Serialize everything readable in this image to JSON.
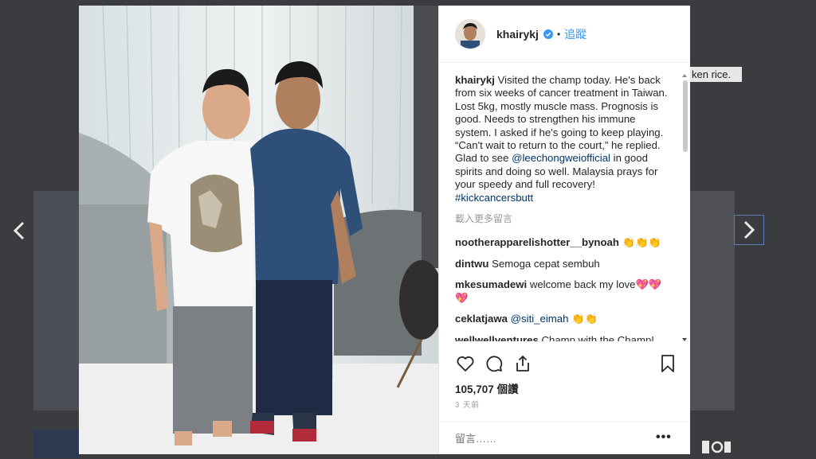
{
  "background": {
    "partial_text": "ken rice."
  },
  "post": {
    "username": "khairykj",
    "follow_label": "追蹤",
    "caption_username": "khairykj",
    "caption_before": " Visited the champ today. He's back from six weeks of cancer treatment in Taiwan. Lost 5kg, mostly muscle mass. Prognosis is good. Needs to strengthen his immune system. I asked if he's going to keep playing. “Can't wait to return to the court,” he replied. Glad to see ",
    "caption_mention": "@leechongweiofficial",
    "caption_middle": " in good spirits and doing so well. Malaysia prays for your speedy and full recovery! ",
    "caption_hashtag": "#kickcancersbutt",
    "load_more": "載入更多留言",
    "comments": [
      {
        "user": "nootherapparelishotter__bynoah",
        "text": " 👏👏👏"
      },
      {
        "user": "dintwu",
        "text": " Semoga cepat sembuh"
      },
      {
        "user": "mkesumadewi",
        "text": " welcome back my love💖💖💖"
      },
      {
        "user": "ceklatjawa",
        "text": " 👏👏",
        "mention": "@siti_eimah"
      },
      {
        "user": "wellwellventures",
        "text": " Champ with the Champ! 👏👏"
      }
    ],
    "likes": "105,707",
    "likes_label": "個讚",
    "time": "3 天前",
    "comment_placeholder": "留言……",
    "colors": {
      "link": "#003569",
      "follow": "#3897f0",
      "verified": "#3897f0"
    }
  }
}
